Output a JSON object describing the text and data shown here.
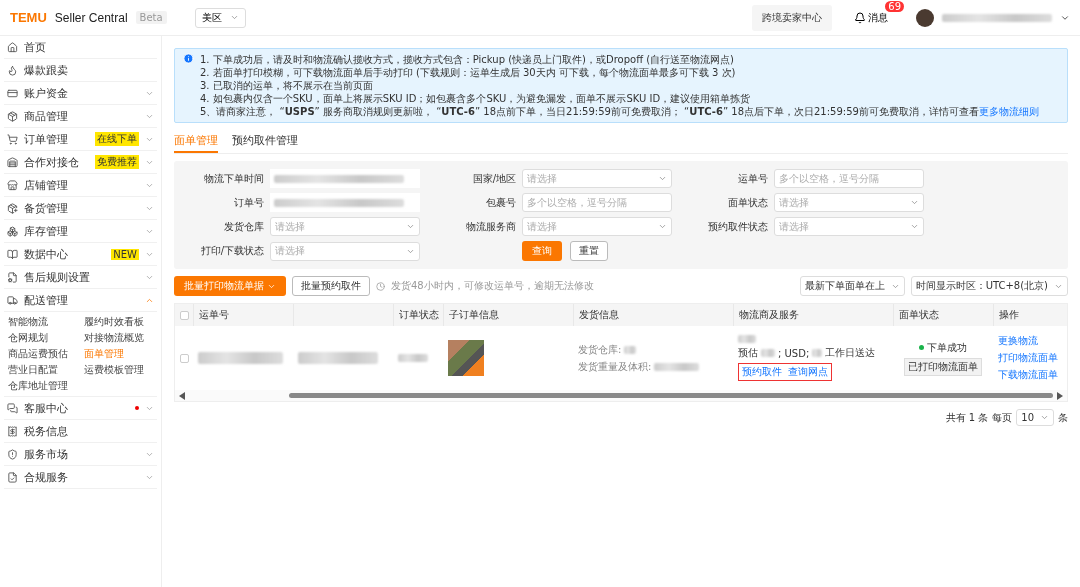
{
  "header": {
    "brand": "TEMU",
    "product": "Seller Central",
    "beta": "Beta",
    "region": "美区",
    "center_button": "跨境卖家中心",
    "messages": "消息",
    "message_count": "69"
  },
  "sidebar": {
    "items": [
      {
        "label": "首页",
        "expandable": false
      },
      {
        "label": "爆款跟卖",
        "expandable": false
      },
      {
        "label": "账户资金",
        "expandable": true,
        "expanded": false
      },
      {
        "label": "商品管理",
        "expandable": true,
        "expanded": false
      },
      {
        "label": "订单管理",
        "badge": "在线下单",
        "expandable": true,
        "expanded": false
      },
      {
        "label": "合作对接仓",
        "badge": "免费推荐",
        "expandable": true,
        "expanded": false
      },
      {
        "label": "店铺管理",
        "expandable": true,
        "expanded": false
      },
      {
        "label": "备货管理",
        "expandable": true,
        "expanded": false
      },
      {
        "label": "库存管理",
        "expandable": true,
        "expanded": false
      },
      {
        "label": "数据中心",
        "badge": "NEW",
        "expandable": true,
        "expanded": false
      },
      {
        "label": "售后规则设置",
        "expandable": true,
        "expanded": false
      },
      {
        "label": "配送管理",
        "expandable": true,
        "expanded": true,
        "children": [
          {
            "label": "智能物流",
            "selected": false
          },
          {
            "label": "履约时效看板",
            "selected": false
          },
          {
            "label": "仓网规划",
            "selected": false
          },
          {
            "label": "对接物流概览",
            "selected": false
          },
          {
            "label": "商品运费预估",
            "selected": false
          },
          {
            "label": "面单管理",
            "selected": true
          },
          {
            "label": "营业日配置",
            "selected": false
          },
          {
            "label": "运费模板管理",
            "selected": false
          },
          {
            "label": "仓库地址管理",
            "selected": false
          }
        ]
      },
      {
        "label": "客服中心",
        "dot": true,
        "expandable": true,
        "expanded": false
      },
      {
        "label": "税务信息",
        "expandable": false
      },
      {
        "label": "服务市场",
        "expandable": true,
        "expanded": false
      },
      {
        "label": "合规服务",
        "expandable": true,
        "expanded": false
      }
    ]
  },
  "notice": {
    "lines": [
      "1. 下单成功后，请及时和物流确认揽收方式，揽收方式包含：Pickup (快递员上门取件)，或Dropoff (自行送至物流网点)",
      "2. 若面单打印模糊，可下载物流面单后手动打印 (下载规则：运单生成后 30天内 可下载，每个物流面单最多可下载 3 次)",
      "3. 已取消的运单，将不展示在当前页面",
      "4. 如包裹内仅含一个SKU，面单上将展示SKU ID；如包裹含多个SKU，为避免漏发，面单不展示SKU ID，建议使用箱单拣货",
      "5、请商家注意， “**USPS**” 服务商取消规则更新啦， “**UTC-6**” 18点前下单，当日21:59:59前可免费取消； “**UTC-6**” 18点后下单，次日21:59:59前可免费取消，详情可查看"
    ],
    "link": "更多物流细则"
  },
  "tabs": [
    {
      "label": "面单管理",
      "selected": true
    },
    {
      "label": "预约取件管理",
      "selected": false
    }
  ],
  "filters": [
    {
      "label": "物流下单时间",
      "kind": "blurred"
    },
    {
      "label": "国家/地区",
      "kind": "select",
      "placeholder": "请选择"
    },
    {
      "label": "运单号",
      "kind": "text",
      "placeholder": "多个以空格，逗号分隔"
    },
    {
      "label": "订单号",
      "kind": "blurred"
    },
    {
      "label": "包裹号",
      "kind": "text",
      "placeholder": "多个以空格，逗号分隔"
    },
    {
      "label": "面单状态",
      "kind": "select",
      "placeholder": "请选择"
    },
    {
      "label": "发货仓库",
      "kind": "select",
      "placeholder": "请选择"
    },
    {
      "label": "物流服务商",
      "kind": "select",
      "placeholder": "请选择"
    },
    {
      "label": "预约取件状态",
      "kind": "select",
      "placeholder": "请选择"
    },
    {
      "label": "打印/下载状态",
      "kind": "select",
      "placeholder": "请选择"
    }
  ],
  "filter_buttons": {
    "search": "查询",
    "reset": "重置"
  },
  "actions": {
    "batch_print": "批量打印物流单据",
    "batch_pickup": "批量预约取件",
    "hint": "发货48小时内，可修改运单号，逾期无法修改",
    "sort": "最新下单面单在上",
    "timezone": "时间显示时区：UTC+8(北京)"
  },
  "table": {
    "select_all_checked": false,
    "columns": [
      "运单号",
      "",
      "订单状态",
      "子订单信息",
      "发货信息",
      "物流商及服务",
      "面单状态",
      "操作"
    ],
    "rows": [
      {
        "checked": false,
        "ship_labels": [
          "发货仓库:",
          "发货重量及体积:"
        ],
        "estimate": [
          "预估",
          "; USD;",
          "工作日送达"
        ],
        "service_links": [
          "预约取件",
          "查询网点"
        ],
        "status": "下单成功",
        "tag": "已打印物流面单",
        "operations": [
          "更换物流",
          "打印物流面单",
          "下载物流面单"
        ]
      }
    ]
  },
  "pagination": {
    "total": "共有 1 条",
    "per_page_label": "每页",
    "per_page": "10",
    "unit": "条"
  }
}
